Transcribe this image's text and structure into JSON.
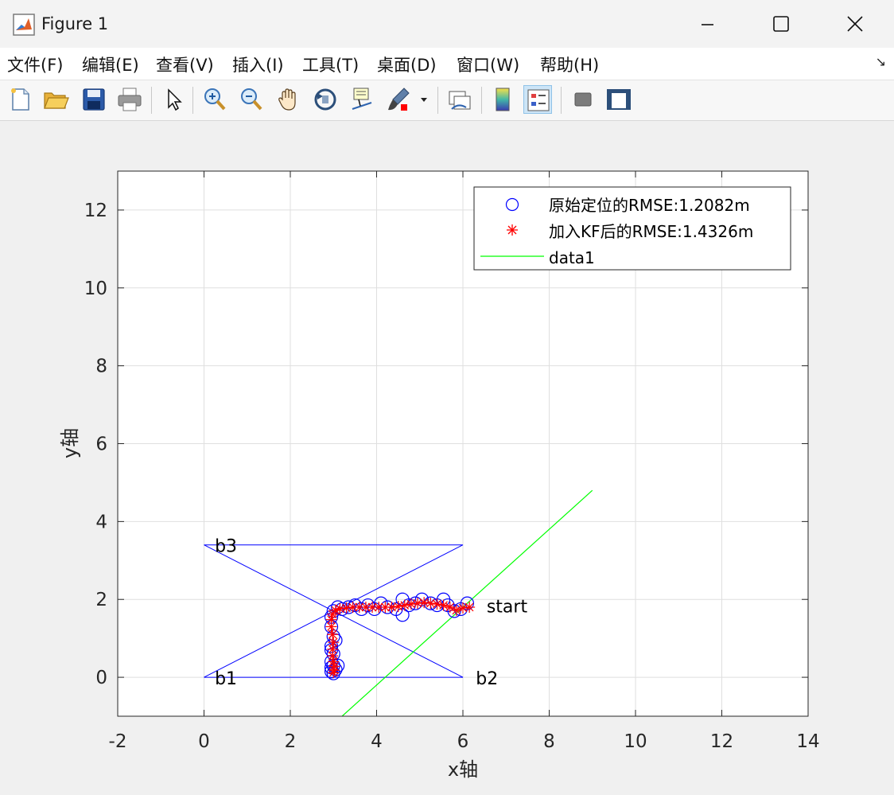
{
  "window": {
    "title": "Figure 1"
  },
  "menu": [
    "文件(F)",
    "编辑(E)",
    "查看(V)",
    "插入(I)",
    "工具(T)",
    "桌面(D)",
    "窗口(W)",
    "帮助(H)"
  ],
  "toolbar": [
    "new-figure",
    "open-file",
    "save",
    "print",
    "select-arrow",
    "zoom-in",
    "zoom-out",
    "pan",
    "rotate-3d",
    "data-cursor",
    "brush",
    "link-plot",
    "colorbar",
    "legend",
    "hide-plot-tools",
    "show-plot-tools"
  ],
  "chart_data": {
    "type": "line",
    "xlabel": "x轴",
    "ylabel": "y轴",
    "xlim": [
      -2,
      14
    ],
    "ylim": [
      -1,
      13
    ],
    "xticks": [
      "-2",
      "0",
      "2",
      "4",
      "6",
      "8",
      "10",
      "12",
      "14"
    ],
    "yticks": [
      "0",
      "2",
      "4",
      "6",
      "8",
      "10",
      "12"
    ],
    "grid": true,
    "legend_position": "top-right",
    "legend": [
      "原始定位的RMSE:1.2082m",
      "加入KF后的RMSE:1.4326m",
      "data1"
    ],
    "annotations": [
      {
        "text": "b1",
        "x": 0.25,
        "y": 0
      },
      {
        "text": "b2",
        "x": 6.3,
        "y": 0
      },
      {
        "text": "b3",
        "x": 0.25,
        "y": 3.4
      },
      {
        "text": "start",
        "x": 6.55,
        "y": 1.85
      }
    ],
    "anchor_lines": {
      "color": "#0000ff",
      "x": [
        0,
        6,
        0,
        6,
        0
      ],
      "y": [
        0,
        0,
        3.4,
        3.4,
        0
      ]
    },
    "series": [
      {
        "name": "原始定位的RMSE:1.2082m",
        "marker": "o",
        "color": "#0000ff",
        "x": [
          6.1,
          5.95,
          5.8,
          5.65,
          5.55,
          5.4,
          5.25,
          5.05,
          4.9,
          4.75,
          4.6,
          4.6,
          4.45,
          4.25,
          4.1,
          3.95,
          3.8,
          3.65,
          3.5,
          3.35,
          3.2,
          3.1,
          3.0,
          2.95,
          2.95,
          3.0,
          2.95,
          3.0,
          3.05,
          2.95,
          2.95,
          3.0,
          2.95,
          3.05,
          3.1,
          3.0,
          2.95
        ],
        "y": [
          1.9,
          1.75,
          1.7,
          1.85,
          2.0,
          1.85,
          1.9,
          2.0,
          1.9,
          1.85,
          2.0,
          1.6,
          1.75,
          1.8,
          1.9,
          1.75,
          1.85,
          1.75,
          1.85,
          1.8,
          1.75,
          1.8,
          1.7,
          1.55,
          1.3,
          1.05,
          0.8,
          0.6,
          0.95,
          0.7,
          0.4,
          0.3,
          0.15,
          0.2,
          0.3,
          0.1,
          0.25
        ]
      },
      {
        "name": "加入KF后的RMSE:1.4326m",
        "marker": "*",
        "color": "#ff0000",
        "x": [
          6.15,
          6.0,
          5.85,
          5.7,
          5.55,
          5.4,
          5.25,
          5.1,
          4.95,
          4.8,
          4.65,
          4.5,
          4.35,
          4.2,
          4.05,
          3.9,
          3.75,
          3.6,
          3.45,
          3.3,
          3.15,
          3.05,
          2.98,
          2.95,
          2.95,
          2.98,
          3.0,
          2.98,
          2.98,
          3.0,
          3.02,
          3.02,
          3.0
        ],
        "y": [
          1.8,
          1.78,
          1.72,
          1.8,
          1.85,
          1.88,
          1.9,
          1.92,
          1.9,
          1.88,
          1.85,
          1.82,
          1.8,
          1.8,
          1.8,
          1.8,
          1.8,
          1.8,
          1.8,
          1.78,
          1.76,
          1.72,
          1.62,
          1.48,
          1.3,
          1.1,
          0.9,
          0.72,
          0.55,
          0.4,
          0.28,
          0.18,
          0.12
        ]
      },
      {
        "name": "data1",
        "marker": "none",
        "color": "#00ff00",
        "x": [
          3.2,
          9.0
        ],
        "y": [
          -1.0,
          4.8
        ]
      }
    ]
  }
}
